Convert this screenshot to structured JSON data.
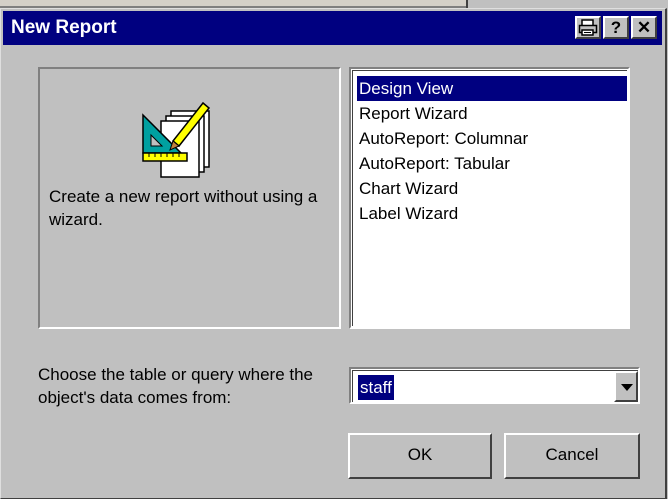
{
  "window": {
    "title": "New Report",
    "buttons": {
      "print_label": "🖨",
      "help_label": "?",
      "close_label": "✕"
    }
  },
  "preview": {
    "icon": "report-design-icon",
    "description": "Create a new report without using a wizard."
  },
  "report_types": {
    "items": [
      {
        "label": "Design View"
      },
      {
        "label": "Report Wizard"
      },
      {
        "label": "AutoReport:  Columnar"
      },
      {
        "label": "AutoReport:  Tabular"
      },
      {
        "label": "Chart Wizard"
      },
      {
        "label": "Label Wizard"
      }
    ],
    "selected": "Design View"
  },
  "source": {
    "label": "Choose the table or query where the object's data comes from:",
    "value": "staff"
  },
  "actions": {
    "ok_label": "OK",
    "cancel_label": "Cancel"
  },
  "colors": {
    "titlebar": "#000080",
    "face": "#c0c0c0",
    "selection": "#000080"
  }
}
